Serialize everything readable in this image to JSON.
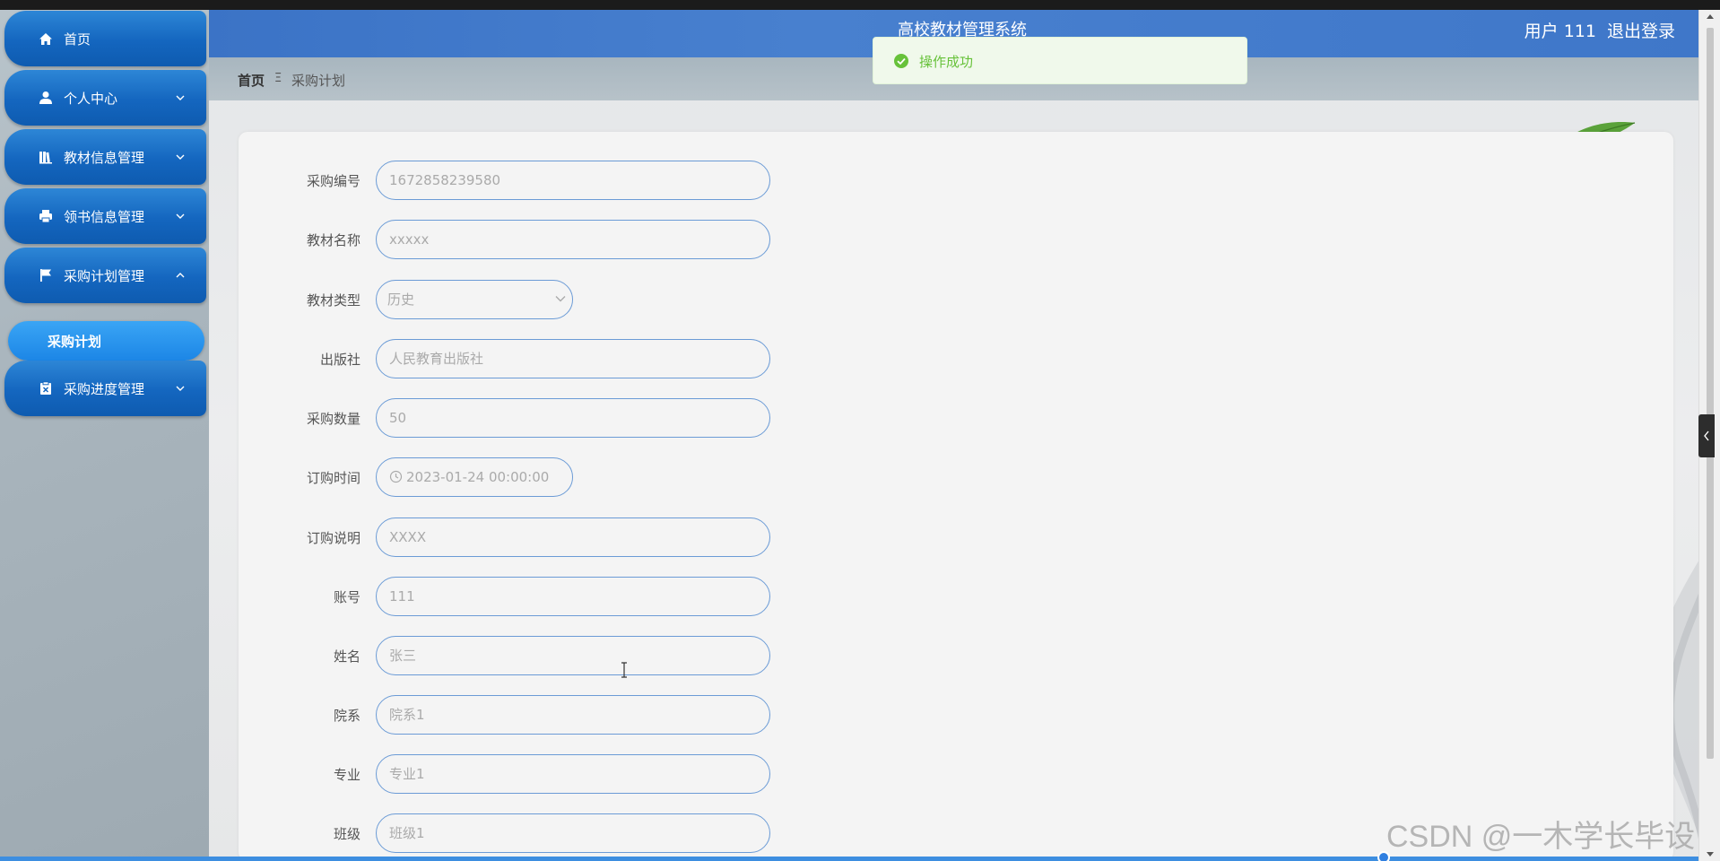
{
  "header": {
    "app_title": "高校教材管理系统",
    "user_label": "用户 111",
    "logout_label": "退出登录"
  },
  "toast": {
    "message": "操作成功"
  },
  "breadcrumb": {
    "home": "首页",
    "separator": "Ξ",
    "current": "采购计划"
  },
  "sidebar": {
    "items": [
      {
        "label": "首页",
        "icon": "home-icon",
        "expanded": null
      },
      {
        "label": "个人中心",
        "icon": "user-icon",
        "expanded": false
      },
      {
        "label": "教材信息管理",
        "icon": "books-icon",
        "expanded": false
      },
      {
        "label": "领书信息管理",
        "icon": "printer-icon",
        "expanded": false
      },
      {
        "label": "采购计划管理",
        "icon": "flag-icon",
        "expanded": true
      },
      {
        "label": "采购进度管理",
        "icon": "clipboard-icon",
        "expanded": false
      }
    ],
    "sub_active": "采购计划"
  },
  "form": {
    "fields": [
      {
        "label": "采购编号",
        "value": "1672858239580"
      },
      {
        "label": "教材名称",
        "value": "xxxxx"
      },
      {
        "label": "教材类型",
        "value": "历史"
      },
      {
        "label": "出版社",
        "value": "人民教育出版社"
      },
      {
        "label": "采购数量",
        "value": "50"
      },
      {
        "label": "订购时间",
        "value": "2023-01-24 00:00:00"
      },
      {
        "label": "订购说明",
        "value": "XXXX"
      },
      {
        "label": "账号",
        "value": "111"
      },
      {
        "label": "姓名",
        "value": "张三"
      },
      {
        "label": "院系",
        "value": "院系1"
      },
      {
        "label": "专业",
        "value": "专业1"
      },
      {
        "label": "班级",
        "value": "班级1"
      }
    ]
  },
  "watermark": "CSDN @一木学长毕设",
  "colors": {
    "header_bg": "#3b73c6",
    "menu_bg": "#1466bf",
    "submenu_bg": "#1c86e6",
    "toast_text": "#67c23a",
    "input_border": "#6b9bd6"
  }
}
